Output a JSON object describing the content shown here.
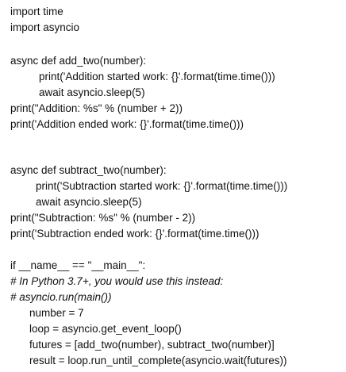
{
  "lines": [
    {
      "text": "import time",
      "indent": 0,
      "italic": false
    },
    {
      "text": "import asyncio",
      "indent": 0,
      "italic": false
    },
    {
      "text": "async def add_two(number):",
      "indent": 0,
      "italic": false
    },
    {
      "text": "print('Addition started work: {}'.format(time.time()))",
      "indent": 2,
      "italic": false
    },
    {
      "text": "await asyncio.sleep(5)",
      "indent": 2,
      "italic": false
    },
    {
      "text": "print(\"Addition: %s\" % (number + 2))",
      "indent": 0,
      "italic": false
    },
    {
      "text": "print('Addition ended work: {}'.format(time.time()))",
      "indent": 0,
      "italic": false
    },
    {
      "text": "async def subtract_two(number):",
      "indent": 0,
      "italic": false
    },
    {
      "text": "print('Subtraction started work: {}'.format(time.time()))",
      "indent": 1,
      "italic": false
    },
    {
      "text": "await asyncio.sleep(5)",
      "indent": 1,
      "italic": false
    },
    {
      "text": "print(\"Subtraction: %s\" % (number - 2))",
      "indent": 0,
      "italic": false
    },
    {
      "text": "print('Subtraction ended work: {}'.format(time.time()))",
      "indent": 0,
      "italic": false
    },
    {
      "text": "if __name__ == \"__main__\":",
      "indent": 0,
      "italic": false
    },
    {
      "text": "# In Python 3.7+, you would use this instead:",
      "indent": 0,
      "italic": true
    },
    {
      "text": "# asyncio.run(main())",
      "indent": 0,
      "italic": true
    },
    {
      "text": "number = 7",
      "indent": 3,
      "italic": false
    },
    {
      "text": "loop = asyncio.get_event_loop()",
      "indent": 3,
      "italic": false
    },
    {
      "text": "futures = [add_two(number), subtract_two(number)]",
      "indent": 3,
      "italic": false
    },
    {
      "text": "result = loop.run_until_complete(asyncio.wait(futures))",
      "indent": 3,
      "italic": false
    }
  ]
}
